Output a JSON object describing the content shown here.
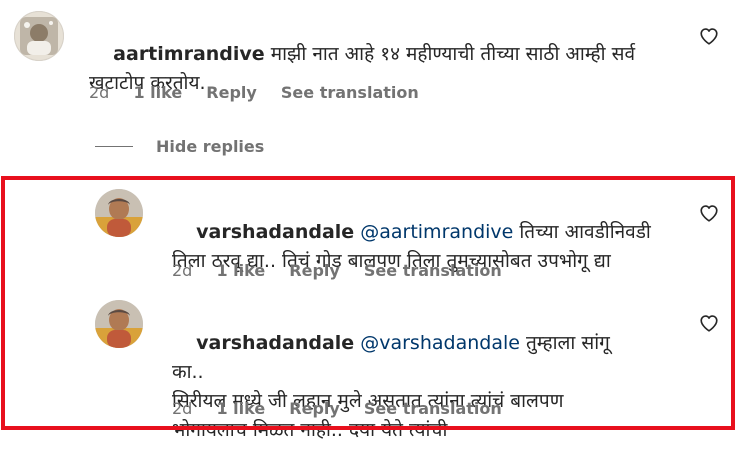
{
  "comments": [
    {
      "username": "aartimrandive",
      "mention": "",
      "text": " माझी नात आहे १४ महीण्याची तीच्या साठी आम्ही सर्व खटाटोप करतोय.",
      "time": "2d",
      "likes": "1 like",
      "reply": "Reply",
      "translation": "See translation"
    },
    {
      "username": "varshadandale",
      "mention": "@aartimrandive",
      "text": " तिच्या आवडीनिवडी तिला ठरवू द्या.. तिचं गोड बालपण तिला तुमच्यासोबत उपभोगू द्या",
      "time": "2d",
      "likes": "1 like",
      "reply": "Reply",
      "translation": "See translation"
    },
    {
      "username": "varshadandale",
      "mention": "@varshadandale",
      "text": " तुम्हाला सांगू का..\nसिरीयल मध्ये जी लहान मुले असतात त्यांना त्यांचं बालपण भोगायलाच मिळत नाही.. दया येते त्यांची",
      "time": "2d",
      "likes": "1 like",
      "reply": "Reply",
      "translation": "See translation"
    }
  ],
  "hide_replies": "Hide replies",
  "icons": {
    "like": "heart-outline-icon",
    "avatar": "user-avatar"
  },
  "colors": {
    "text": "#262626",
    "secondary": "#737373",
    "mention": "#00376b",
    "highlight": "#e8101d"
  }
}
